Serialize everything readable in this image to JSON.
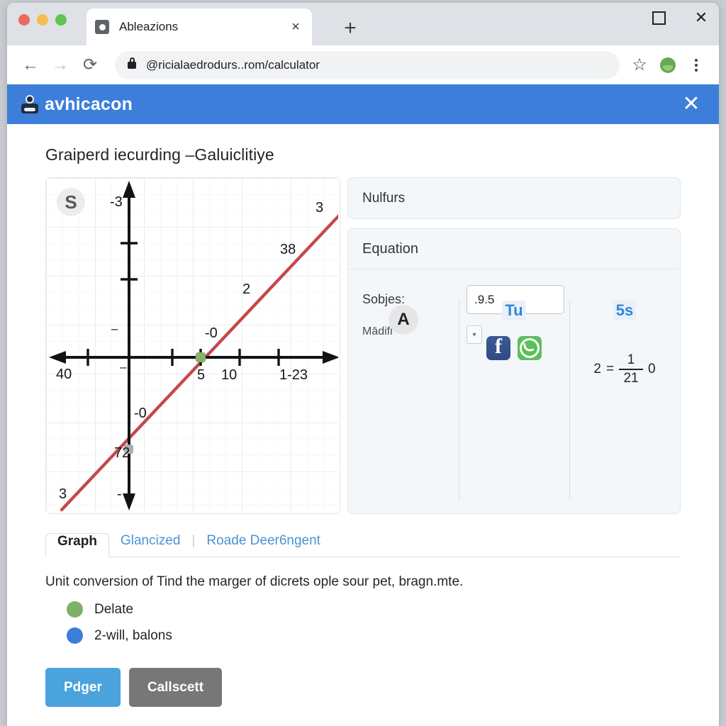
{
  "window": {
    "controls": {
      "maximize_icon": "maximize-icon",
      "close_icon": "close-icon"
    },
    "traffic_lights": [
      "close",
      "minimize",
      "zoom"
    ]
  },
  "browser": {
    "tab": {
      "title": "Ableazions",
      "close_label": "×",
      "favicon": "camera-icon"
    },
    "new_tab_label": "+",
    "back_label": "←",
    "forward_label": "→",
    "reload_label": "⟳",
    "url": "@ricialaedrodurs..rom/calculator",
    "bookmark_label": "☆",
    "profile_icon": "profile-avatar-icon",
    "menu_icon": "kebab-menu-icon"
  },
  "banner": {
    "title": "avhicacon",
    "icon": "robot-icon",
    "close_label": "✕",
    "color": "#3d7edb"
  },
  "page": {
    "title": "Graiperd iecurding –Galuiclitiye"
  },
  "graph": {
    "badge": "S",
    "labels": {
      "top_y": "-3",
      "top_right": "3",
      "line_mid": "38",
      "line_low": "2",
      "above_origin": "-0",
      "left_x": "40",
      "tick5": "5",
      "tick10": "10",
      "right_x": "1-23",
      "below_origin": "-0",
      "y_intercept": "72",
      "bottom_left": "3",
      "bottom_y": "-"
    }
  },
  "chart_data": {
    "type": "line",
    "title": "Graiperd iecurding –Galuiclitiye",
    "xlabel": "",
    "ylabel": "",
    "grid": true,
    "legend": "none",
    "xlim": [
      -6,
      8
    ],
    "ylim": [
      -5,
      5
    ],
    "x_ticks": [
      "40",
      "5",
      "10",
      "1-23"
    ],
    "y_ticks": [
      "-3",
      "-0",
      "72",
      "3",
      "-"
    ],
    "series": [
      {
        "name": "line",
        "color": "#c4484a",
        "points": [
          [
            -6,
            -4.6
          ],
          [
            8,
            4.3
          ]
        ],
        "annotations": [
          "3",
          "38",
          "2",
          "-0"
        ]
      }
    ],
    "markers": [
      {
        "name": "x-intercept",
        "x": 1.6,
        "y": 0,
        "color": "#8ab06a",
        "label": "5"
      },
      {
        "name": "y-intercept",
        "x": 0,
        "y": -1.6,
        "color": "#9aa3ad",
        "label": "72"
      }
    ]
  },
  "panels": {
    "nulfurs": {
      "title": "Nulfurs"
    },
    "equation": {
      "title": "Equation",
      "field_label": "Sobjes:",
      "field_value": ".9.5",
      "field_placeholder": "",
      "modify_label": "Mādifi",
      "select_icon": "chevron-down-icon",
      "columns": [
        {
          "name": "avatar-column",
          "avatar": "A"
        },
        {
          "name": "share-column",
          "chip": "Tu",
          "social": [
            "facebook-icon",
            "whatsapp-icon"
          ]
        },
        {
          "name": "formula-column",
          "chip": "5s",
          "formula": {
            "lhs": "2",
            "eq": "=",
            "num": "1",
            "den": "21",
            "rhs": "0"
          }
        }
      ]
    }
  },
  "tabs": {
    "items": [
      {
        "label": "Graph",
        "active": true
      },
      {
        "label": "Glancized",
        "active": false
      },
      {
        "label": "Roade Deer6ngent",
        "active": false
      }
    ],
    "separator": "|"
  },
  "description": "Unit conversion of Tind the marger of dicrets ople sour pet, bragn.mte.",
  "legend": [
    {
      "label": "Delate",
      "color": "#7fb069"
    },
    {
      "label": "2-will, balons",
      "color": "#3b7dd8"
    }
  ],
  "actions": {
    "primary": {
      "label": "Pdger",
      "color": "#4aa3dc"
    },
    "secondary": {
      "label": "Callscett",
      "color": "#777777"
    }
  }
}
